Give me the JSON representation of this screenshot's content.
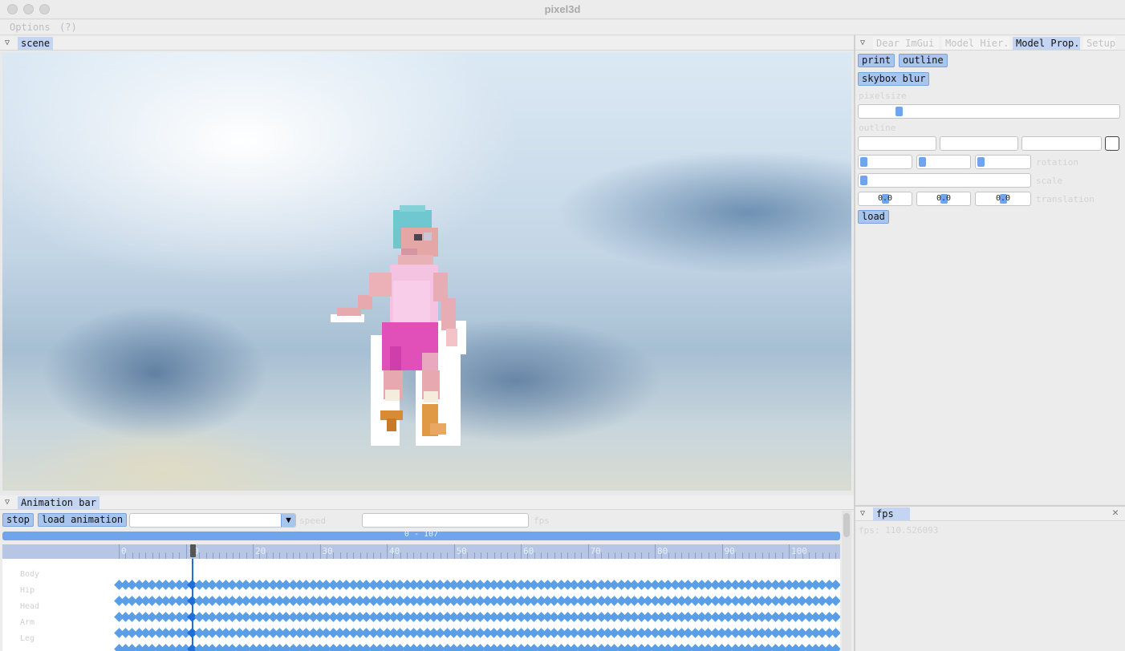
{
  "window": {
    "title": "pixel3d"
  },
  "menu": {
    "items": [
      "Options",
      "(?)"
    ]
  },
  "scene_panel": {
    "tab": "scene"
  },
  "tools_panel": {
    "tabs": [
      {
        "label": "Dear ImGui",
        "active": false
      },
      {
        "label": "Model Hier.",
        "active": false
      },
      {
        "label": "Model Prop.",
        "active": true
      },
      {
        "label": "Setup",
        "active": false
      }
    ],
    "buttons": {
      "print": "print",
      "outline": "outline",
      "skybox_blur": "skybox blur",
      "load": "load"
    },
    "pixel_size_label": "pixelsize",
    "pixel_size_value": 0.14,
    "outline_label": "outline",
    "rotation_label": "rotation",
    "scale_label": "scale",
    "translation_label": "translation",
    "translation_values": [
      "0.0",
      "0.0",
      "0.0"
    ]
  },
  "fps_panel": {
    "tab": "fps",
    "text": "fps: 110.526093"
  },
  "animation_panel": {
    "tab": "Animation bar",
    "stop_label": "stop",
    "load_animation_label": "load animation",
    "speed_label": "speed",
    "fps_label": "fps",
    "range_label": "0 - 107",
    "current_frame": 11,
    "frame_range": [
      0,
      107
    ],
    "tick_labels": [
      "0",
      "10",
      "20",
      "30",
      "40",
      "50",
      "60",
      "70",
      "80",
      "90",
      "100"
    ],
    "track_labels": [
      "Body",
      "Hip",
      "Head",
      "Arm",
      "Leg"
    ]
  },
  "colors": {
    "accent": "#6fa5ec",
    "button": "#a8c5ee",
    "keyframe": "#5b9ee8",
    "playhead": "#1e6fd8"
  }
}
